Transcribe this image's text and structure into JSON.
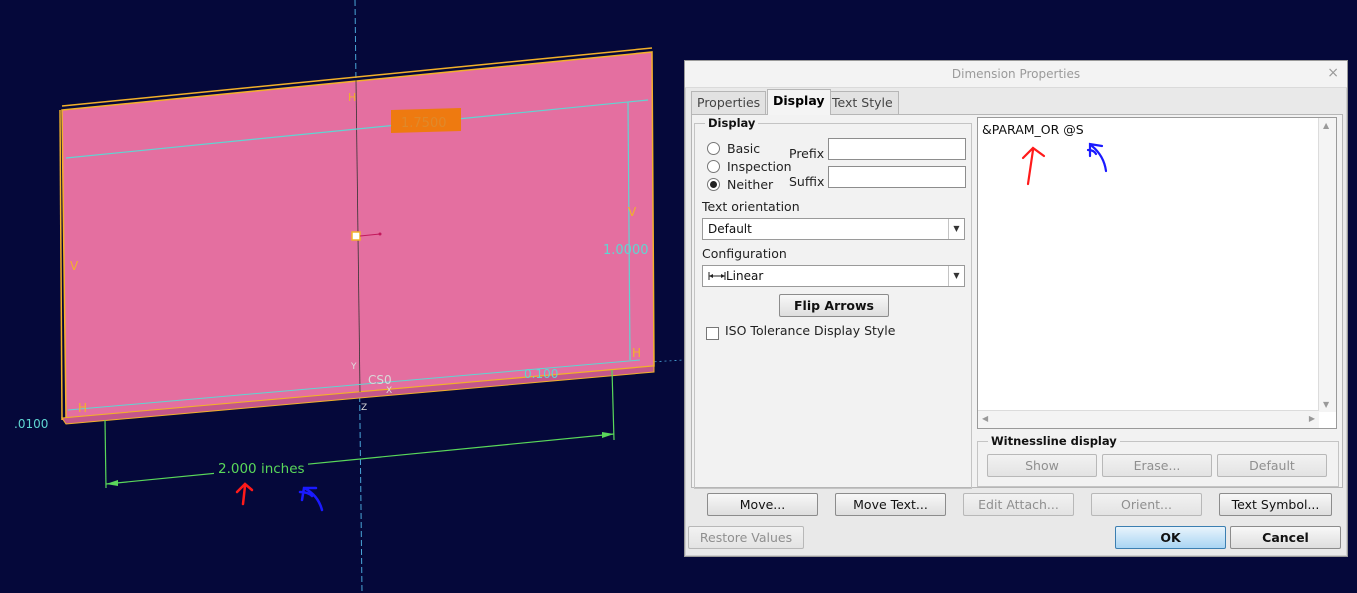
{
  "viewport": {
    "dim_top_value": "1.7500",
    "dim_right_value": "1.0000",
    "dim_left_value": ".0100",
    "dim_bottom_right_value": "0.100",
    "dim_bottom_text": "2.000 inches",
    "csys_label": "CS0",
    "marker_h": "H",
    "marker_v": "V",
    "marker_x": "X",
    "marker_y": "Y",
    "marker_z": "Z"
  },
  "dialog": {
    "title": "Dimension Properties",
    "close_glyph": "×",
    "tabs": [
      {
        "label": "Properties"
      },
      {
        "label": "Display"
      },
      {
        "label": "Text Style"
      }
    ],
    "display_group": {
      "label": "Display",
      "radios": [
        {
          "label": "Basic",
          "checked": false
        },
        {
          "label": "Inspection",
          "checked": false
        },
        {
          "label": "Neither",
          "checked": true
        }
      ],
      "prefix_label": "Prefix",
      "prefix_value": "",
      "suffix_label": "Suffix",
      "suffix_value": "",
      "text_orientation_label": "Text orientation",
      "text_orientation_value": "Default",
      "configuration_label": "Configuration",
      "configuration_value": "Linear",
      "flip_arrows_label": "Flip Arrows",
      "iso_label": "ISO Tolerance Display Style"
    },
    "dimension_text": "&PARAM_OR @S",
    "witnessline": {
      "label": "Witnessline display",
      "show": "Show",
      "erase": "Erase...",
      "default": "Default"
    },
    "buttons": {
      "move": "Move...",
      "move_text": "Move Text...",
      "edit_attach": "Edit Attach...",
      "orient": "Orient...",
      "text_symbol": "Text Symbol...",
      "restore_values": "Restore Values",
      "ok": "OK",
      "cancel": "Cancel"
    }
  },
  "colors": {
    "background": "#05083a",
    "part_fill": "#e46fa0",
    "edge_yellow": "#f2b12a",
    "dimension_cyan": "#5fd6d2",
    "dimension_green": "#5ad85a",
    "annotation_red": "#ff1a1a",
    "annotation_blue": "#1a1aff"
  }
}
